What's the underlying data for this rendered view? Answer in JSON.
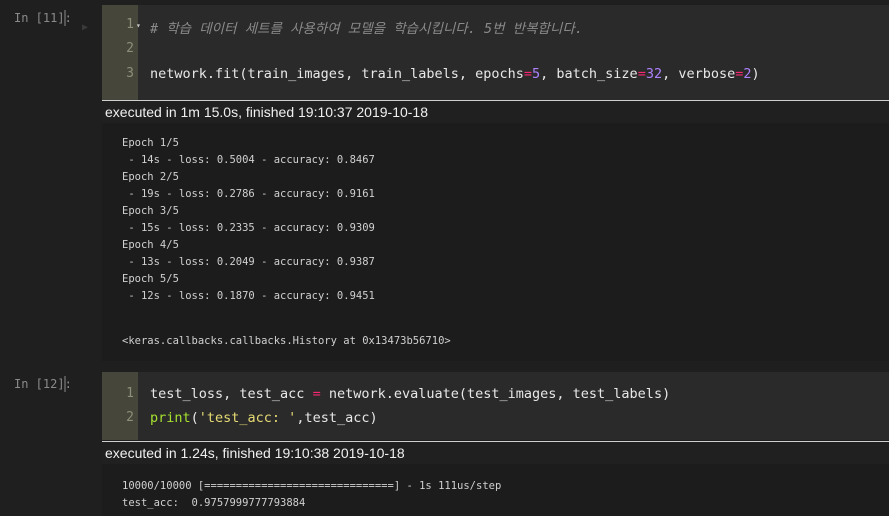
{
  "cells": [
    {
      "prompt": "In [11]:",
      "lines": [
        {
          "n": "1",
          "comment": "# 학습 데이터 세트를 사용하여 모델을 학습시킵니다. 5번 반복합니다."
        },
        {
          "n": "2"
        },
        {
          "n": "3",
          "p1": "network.fit(train_images, train_labels, epochs",
          "eq1": "=",
          "v1": "5",
          "p2": ", batch_size",
          "eq2": "=",
          "v2": "32",
          "p3": ", verbose",
          "eq3": "=",
          "v3": "2",
          "p4": ")"
        }
      ],
      "exec": "executed in 1m 15.0s, finished 19:10:37 2019-10-18",
      "output": [
        "Epoch 1/5",
        " - 14s - loss: 0.5004 - accuracy: 0.8467",
        "Epoch 2/5",
        " - 19s - loss: 0.2786 - accuracy: 0.9161",
        "Epoch 3/5",
        " - 15s - loss: 0.2335 - accuracy: 0.9309",
        "Epoch 4/5",
        " - 13s - loss: 0.2049 - accuracy: 0.9387",
        "Epoch 5/5",
        " - 12s - loss: 0.1870 - accuracy: 0.9451"
      ],
      "result": "<keras.callbacks.callbacks.History at 0x13473b56710>"
    },
    {
      "prompt": "In [12]:",
      "lines": [
        {
          "n": "1",
          "p1": "test_loss, test_acc ",
          "eq": "=",
          "p2": " network.evaluate(test_images, test_labels)"
        },
        {
          "n": "2",
          "fn": "print",
          "p1": "(",
          "str": "'test_acc: '",
          "p2": ",test_acc)"
        }
      ],
      "exec": "executed in 1.24s, finished 19:10:38 2019-10-18",
      "output": [
        "10000/10000 [==============================] - 1s 111us/step",
        "test_acc:  0.9757999777793884"
      ]
    }
  ]
}
